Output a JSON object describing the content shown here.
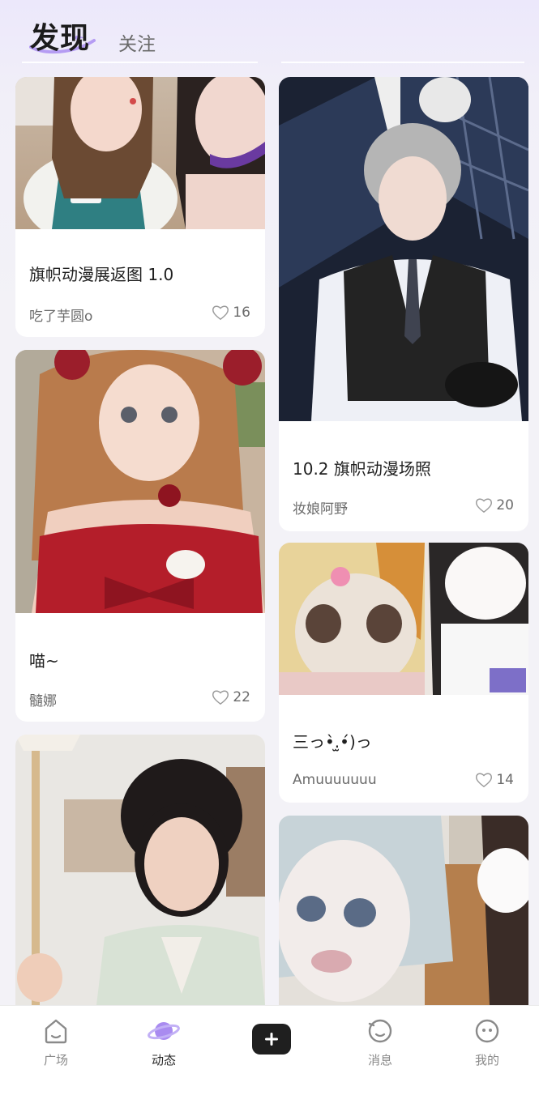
{
  "header": {
    "tabs": [
      {
        "label": "发现",
        "active": true
      },
      {
        "label": "关注",
        "active": false
      }
    ],
    "accent_color": "#a98bf0"
  },
  "feed": {
    "left_column": [
      {
        "title": "旗帜动漫展返图 1.0",
        "author": "吃了芋圆o",
        "likes": "16",
        "image": "photo-two-cosplayers-selfie"
      },
      {
        "title": "喵~",
        "author": "髓娜",
        "likes": "22",
        "image": "photo-cosplayer-red-dress"
      },
      {
        "title": "",
        "author": "",
        "likes": "",
        "image": "photo-cosplayer-with-umbrella"
      }
    ],
    "right_column": [
      {
        "title": "10.2 旗帜动漫场照",
        "author": "妆娘阿野",
        "likes": "20",
        "image": "photo-bunny-ears-cosplayer"
      },
      {
        "title": "三っ•̀.̫•́)っ",
        "author": "Amuuuuuuu",
        "likes": "14",
        "image": "photo-fursuit-blonde"
      },
      {
        "title": "",
        "author": "",
        "likes": "",
        "image": "photo-fursuit-white"
      }
    ]
  },
  "bottom_nav": {
    "items": [
      {
        "label": "广场",
        "icon": "house-face-icon",
        "active": false
      },
      {
        "label": "动态",
        "icon": "planet-icon",
        "active": true
      },
      {
        "label": "",
        "icon": "plus-icon",
        "active": false
      },
      {
        "label": "消息",
        "icon": "chat-face-icon",
        "active": false
      },
      {
        "label": "我的",
        "icon": "profile-face-icon",
        "active": false
      }
    ]
  }
}
